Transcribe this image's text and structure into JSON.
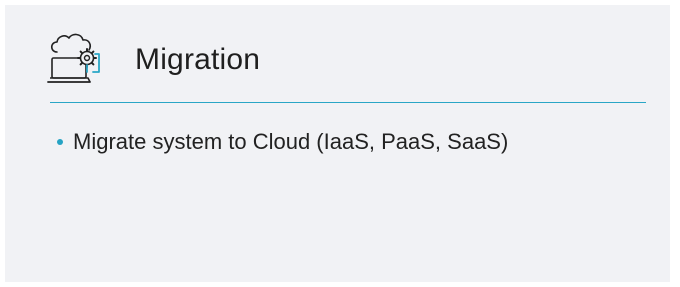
{
  "slide": {
    "title": "Migration",
    "icon": "cloud-laptop-migration-icon",
    "accent_color": "#2aa6c6",
    "background_color": "#f1f2f5",
    "bullets": [
      "Migrate system to Cloud (IaaS, PaaS, SaaS)"
    ]
  }
}
